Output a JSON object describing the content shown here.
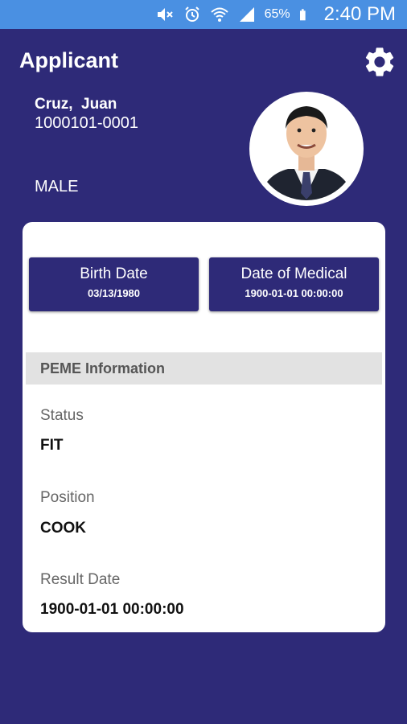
{
  "status_bar": {
    "icons": [
      "mute-icon",
      "alarm-icon",
      "wifi-icon",
      "signal-icon",
      "battery-icon"
    ],
    "battery": "65%",
    "time": "2:40 PM"
  },
  "header": {
    "title": "Applicant",
    "settings_icon": "gear-icon"
  },
  "applicant": {
    "name": "Cruz,  Juan",
    "number": "1000101-0001",
    "gender": "MALE"
  },
  "cards": {
    "birth_label": "Birth Date",
    "birth_value": "03/13/1980",
    "medical_label": "Date of Medical",
    "medical_value": "1900-01-01 00:00:00"
  },
  "peme": {
    "header": "PEME Information",
    "status_label": "Status",
    "status_value": "FIT",
    "position_label": "Position",
    "position_value": "COOK",
    "result_label": "Result Date",
    "result_value": "1900-01-01 00:00:00"
  },
  "colors": {
    "background": "#2e2a78",
    "status_bar": "#4a90e2",
    "section_header": "#e2e2e2"
  }
}
